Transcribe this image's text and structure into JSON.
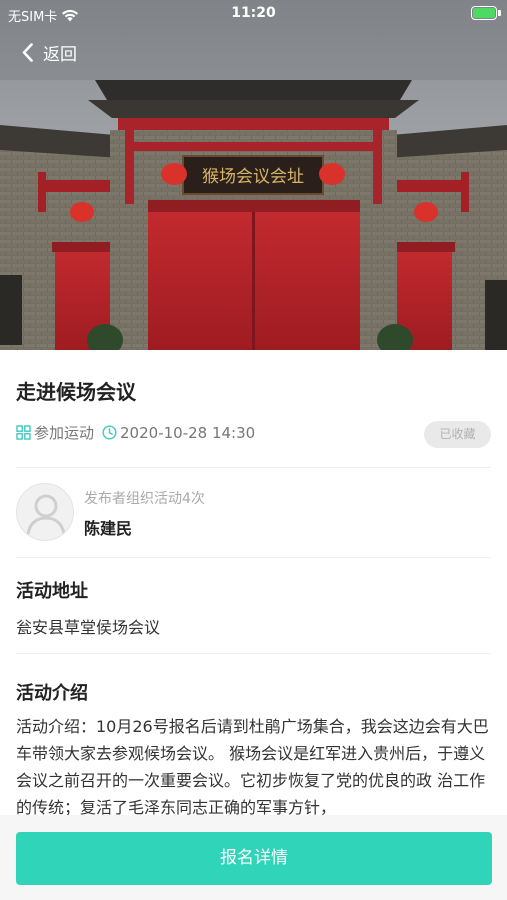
{
  "status_bar": {
    "carrier": "无SIM卡",
    "time": "11:20",
    "battery_level": 1.0
  },
  "nav": {
    "back_label": "返回",
    "back_icon": "chevron-left-icon"
  },
  "hero": {
    "plaque_text": "猴场会议会址"
  },
  "event": {
    "title": "走进候场会议",
    "category": "参加运动",
    "datetime": "2020-10-28 14:30",
    "favorite_label": "已收藏"
  },
  "publisher": {
    "note": "发布者组织活动4次",
    "name": "陈建民"
  },
  "location": {
    "heading": "活动地址",
    "address": "瓮安县草堂侯场会议"
  },
  "intro": {
    "heading": "活动介绍",
    "text": "活动介绍：10月26号报名后请到杜鹃广场集合，我会这边会有大巴车带领大家去参观候场会议。 猴场会议是红军进入贵州后，于遵义会议之前召开的一次重要会议。它初步恢复了党的优良的政 治工作的传统；复活了毛泽东同志正确的军事方针，"
  },
  "footer": {
    "signup_label": "报名详情"
  },
  "colors": {
    "accent": "#2fd4b9",
    "icon_accent": "#3ec8c0",
    "door_red": "#b8252a"
  }
}
